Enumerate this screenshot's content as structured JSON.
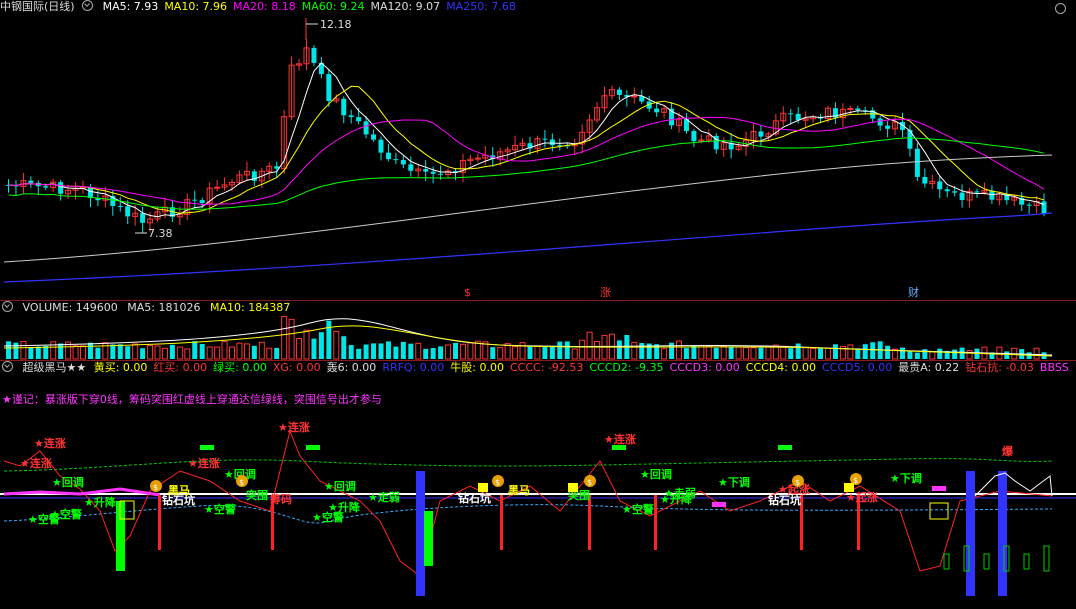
{
  "main": {
    "title": "中钢国际(日线)",
    "ma": [
      {
        "label": "MA5: 7.93",
        "color": "#ffffff"
      },
      {
        "label": "MA10: 7.96",
        "color": "#ffff00"
      },
      {
        "label": "MA20: 8.18",
        "color": "#ff00ff"
      },
      {
        "label": "MA60: 9.24",
        "color": "#00ff00"
      },
      {
        "label": "MA120: 9.07",
        "color": "#dddddd"
      },
      {
        "label": "MA250: 7.68",
        "color": "#3333ff"
      }
    ],
    "high_label": "12.18",
    "low_label": "7.38",
    "markers": [
      {
        "text": "$",
        "color": "#ff3333"
      },
      {
        "text": "涨",
        "color": "#ff3333"
      },
      {
        "text": "财",
        "color": "#66aaff"
      }
    ]
  },
  "volume": {
    "label": "VOLUME: 149600",
    "ma5": "MA5: 181026",
    "ma10": "MA10: 184387"
  },
  "indicator": {
    "name": "超级黑马★★",
    "values": [
      {
        "label": "黄买: 0.00",
        "color": "#ffff00"
      },
      {
        "label": "红买: 0.00",
        "color": "#ff3333"
      },
      {
        "label": "绿买: 0.00",
        "color": "#00ff00"
      },
      {
        "label": "XG: 0.00",
        "color": "#ff3333"
      },
      {
        "label": "轰6: 0.00",
        "color": "#dddddd"
      },
      {
        "label": "RRFQ: 0.00",
        "color": "#3333ff"
      },
      {
        "label": "牛股: 0.00",
        "color": "#ffff00"
      },
      {
        "label": "CCCC: -92.53",
        "color": "#ff3333"
      },
      {
        "label": "CCCD2: -9.35",
        "color": "#00ff00"
      },
      {
        "label": "CCCD3: 0.00",
        "color": "#ff33ff"
      },
      {
        "label": "CCCD4: 0.00",
        "color": "#ffff00"
      },
      {
        "label": "CCCD5: 0.00",
        "color": "#3333ff"
      },
      {
        "label": "最贵A: 0.22",
        "color": "#dddddd"
      },
      {
        "label": "钻石抗: -0.03",
        "color": "#ff3333"
      },
      {
        "label": "BBSS",
        "color": "#ff33ff"
      }
    ],
    "note": "★谨记：暴涨版下穿0线，筹码突围红虚线上穿通达信绿线，突围信号出才参与",
    "labels": {
      "lianzhang": "★连涨",
      "huitiao": "★回调",
      "kongjing": "★空警",
      "shengjiang": "★升降",
      "zhouruo": "★走弱",
      "zhuanshiwang": "钻石坑",
      "heima": "黑马",
      "tuwei": "突围",
      "chouma": "筹码",
      "xiadiao": "★下调",
      "qizhang": "★起涨",
      "bao": "爆"
    }
  }
}
